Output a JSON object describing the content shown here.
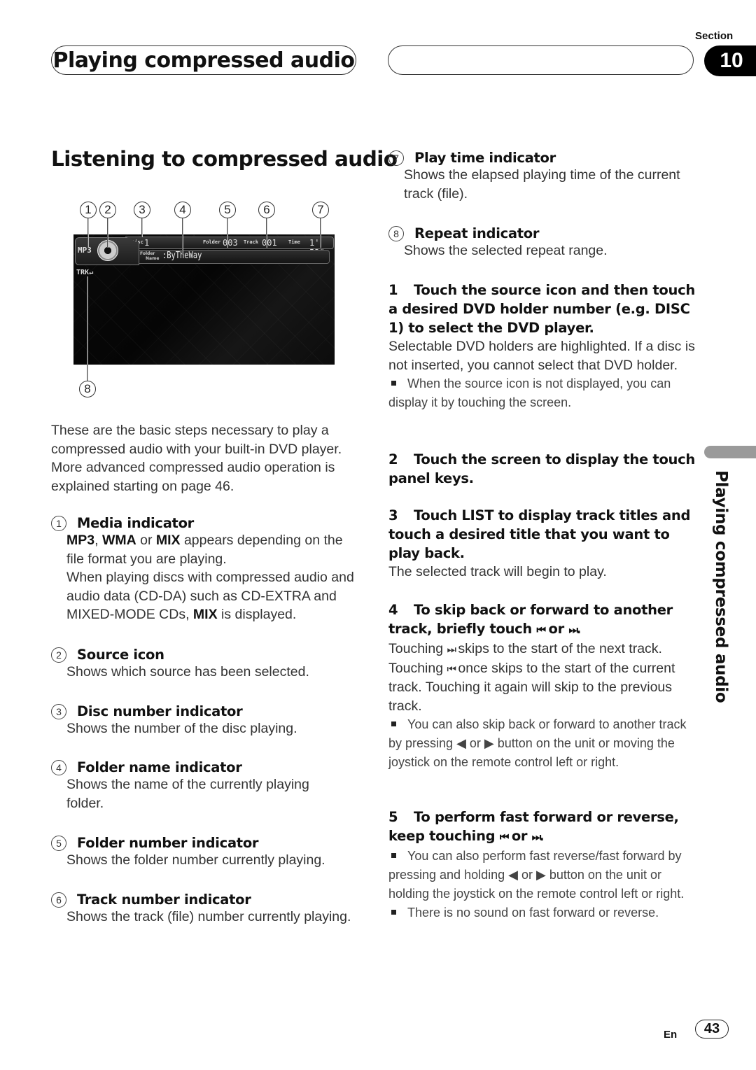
{
  "header": {
    "chapter_title": "Playing compressed audio",
    "section_label": "Section",
    "section_number": "10"
  },
  "side_tab": {
    "label": "Playing compressed audio"
  },
  "footer": {
    "language": "En",
    "page_number": "43"
  },
  "main": {
    "heading": "Listening to compressed audio",
    "screen": {
      "callout_numbers": [
        "1",
        "2",
        "3",
        "4",
        "5",
        "6",
        "7",
        "8"
      ],
      "media_label": "MP3",
      "disc_label": "Disc",
      "disc_value": "1",
      "folder_label": "Folder",
      "folder_value": "003",
      "track_label": "Track",
      "track_value": "001",
      "time_label": "Time",
      "time_value": "1' 53\"",
      "folder_name_label_1": "Folder",
      "folder_name_label_2": "Name",
      "folder_name_value": ":ByTheWay",
      "repeat_label": "TRK"
    },
    "intro": "These are the basic steps necessary to play a compressed audio with your built-in DVD player. More advanced compressed audio operation is explained starting on page 46.",
    "items": [
      {
        "num": "1",
        "title": "Media indicator",
        "body_bold_1": "MP3",
        "body_sep_1": ", ",
        "body_bold_2": "WMA",
        "body_sep_2": " or ",
        "body_bold_3": "MIX",
        "body_rest_1": " appears depending on the file format you are playing.",
        "body_para_2": "When playing discs with compressed audio and audio data (CD-DA) such as CD-EXTRA and MIXED-MODE CDs, ",
        "body_bold_4": "MIX",
        "body_rest_2": " is displayed."
      },
      {
        "num": "2",
        "title": "Source icon",
        "body": "Shows which source has been selected."
      },
      {
        "num": "3",
        "title": "Disc number indicator",
        "body": "Shows the number of the disc playing."
      },
      {
        "num": "4",
        "title": "Folder name indicator",
        "body": "Shows the name of the currently playing folder."
      },
      {
        "num": "5",
        "title": "Folder number indicator",
        "body": "Shows the folder number currently playing."
      },
      {
        "num": "6",
        "title": "Track number indicator",
        "body": "Shows the track (file) number currently playing."
      },
      {
        "num": "7",
        "title": "Play time indicator",
        "body": "Shows the elapsed playing time of the current track (file)."
      },
      {
        "num": "8",
        "title": "Repeat indicator",
        "body": "Shows the selected repeat range."
      }
    ],
    "steps": [
      {
        "num": "1",
        "title": "Touch the source icon and then touch a desired DVD holder number (e.g. DISC 1) to select the DVD player.",
        "body": "Selectable DVD holders are highlighted. If a disc is not inserted, you cannot select that DVD holder.",
        "note": "When the source icon is not displayed, you can display it by touching the screen."
      },
      {
        "num": "2",
        "title": "Touch the screen to display the touch panel keys."
      },
      {
        "num": "3",
        "title": "Touch LIST to display track titles and touch a desired title that you want to play back.",
        "body": "The selected track will begin to play."
      },
      {
        "num": "4",
        "title_a": "To skip back or forward to another track, briefly touch ",
        "title_b": " or ",
        "title_c": ".",
        "body_a": "Touching ",
        "body_b": " skips to the start of the next track. Touching ",
        "body_c": " once skips to the start of the current track. Touching it again will skip to the previous track.",
        "note_a": "You can also skip back or forward to another track by pressing ",
        "note_b": " or ",
        "note_c": " button on the unit or moving the joystick on the remote control left or right."
      },
      {
        "num": "5",
        "title_a": "To perform fast forward or reverse, keep touching ",
        "title_b": " or ",
        "title_c": ".",
        "note1_a": "You can also perform fast reverse/fast forward by pressing and holding ",
        "note1_b": " or ",
        "note1_c": " button on the unit or holding the joystick on the remote control left or right.",
        "note2": "There is no sound on fast forward or reverse."
      }
    ],
    "icons": {
      "prev": "⏮",
      "next": "⏭",
      "left": "◀",
      "right": "▶"
    }
  }
}
